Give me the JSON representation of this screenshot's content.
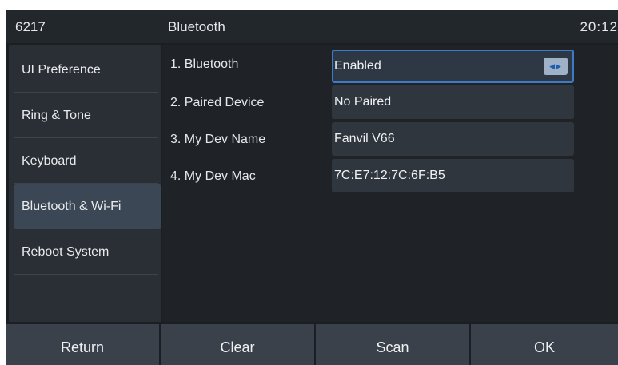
{
  "statusbar": {
    "extension": "6217",
    "title": "Bluetooth",
    "clock": "20:12"
  },
  "sidebar": {
    "items": [
      {
        "label": "UI Preference",
        "active": false
      },
      {
        "label": "Ring & Tone",
        "active": false
      },
      {
        "label": "Keyboard",
        "active": false
      },
      {
        "label": "Bluetooth & Wi-Fi",
        "active": true
      },
      {
        "label": "Reboot System",
        "active": false
      }
    ]
  },
  "settings": {
    "rows": [
      {
        "label": "1. Bluetooth",
        "value": "Enabled",
        "icon": "left-right-arrows-icon"
      },
      {
        "label": "2. Paired Device",
        "value": "No Paired"
      },
      {
        "label": "3. My Dev Name",
        "value": "Fanvil V66"
      },
      {
        "label": "4. My Dev Mac",
        "value": "7C:E7:12:7C:6F:B5"
      }
    ]
  },
  "softkeys": {
    "return_label": "Return",
    "clear_label": "Clear",
    "scan_label": "Scan",
    "ok_label": "OK"
  },
  "colors": {
    "accent": "#3e7bc6",
    "background": "#1b1e22",
    "active_item": "#3b4755"
  }
}
